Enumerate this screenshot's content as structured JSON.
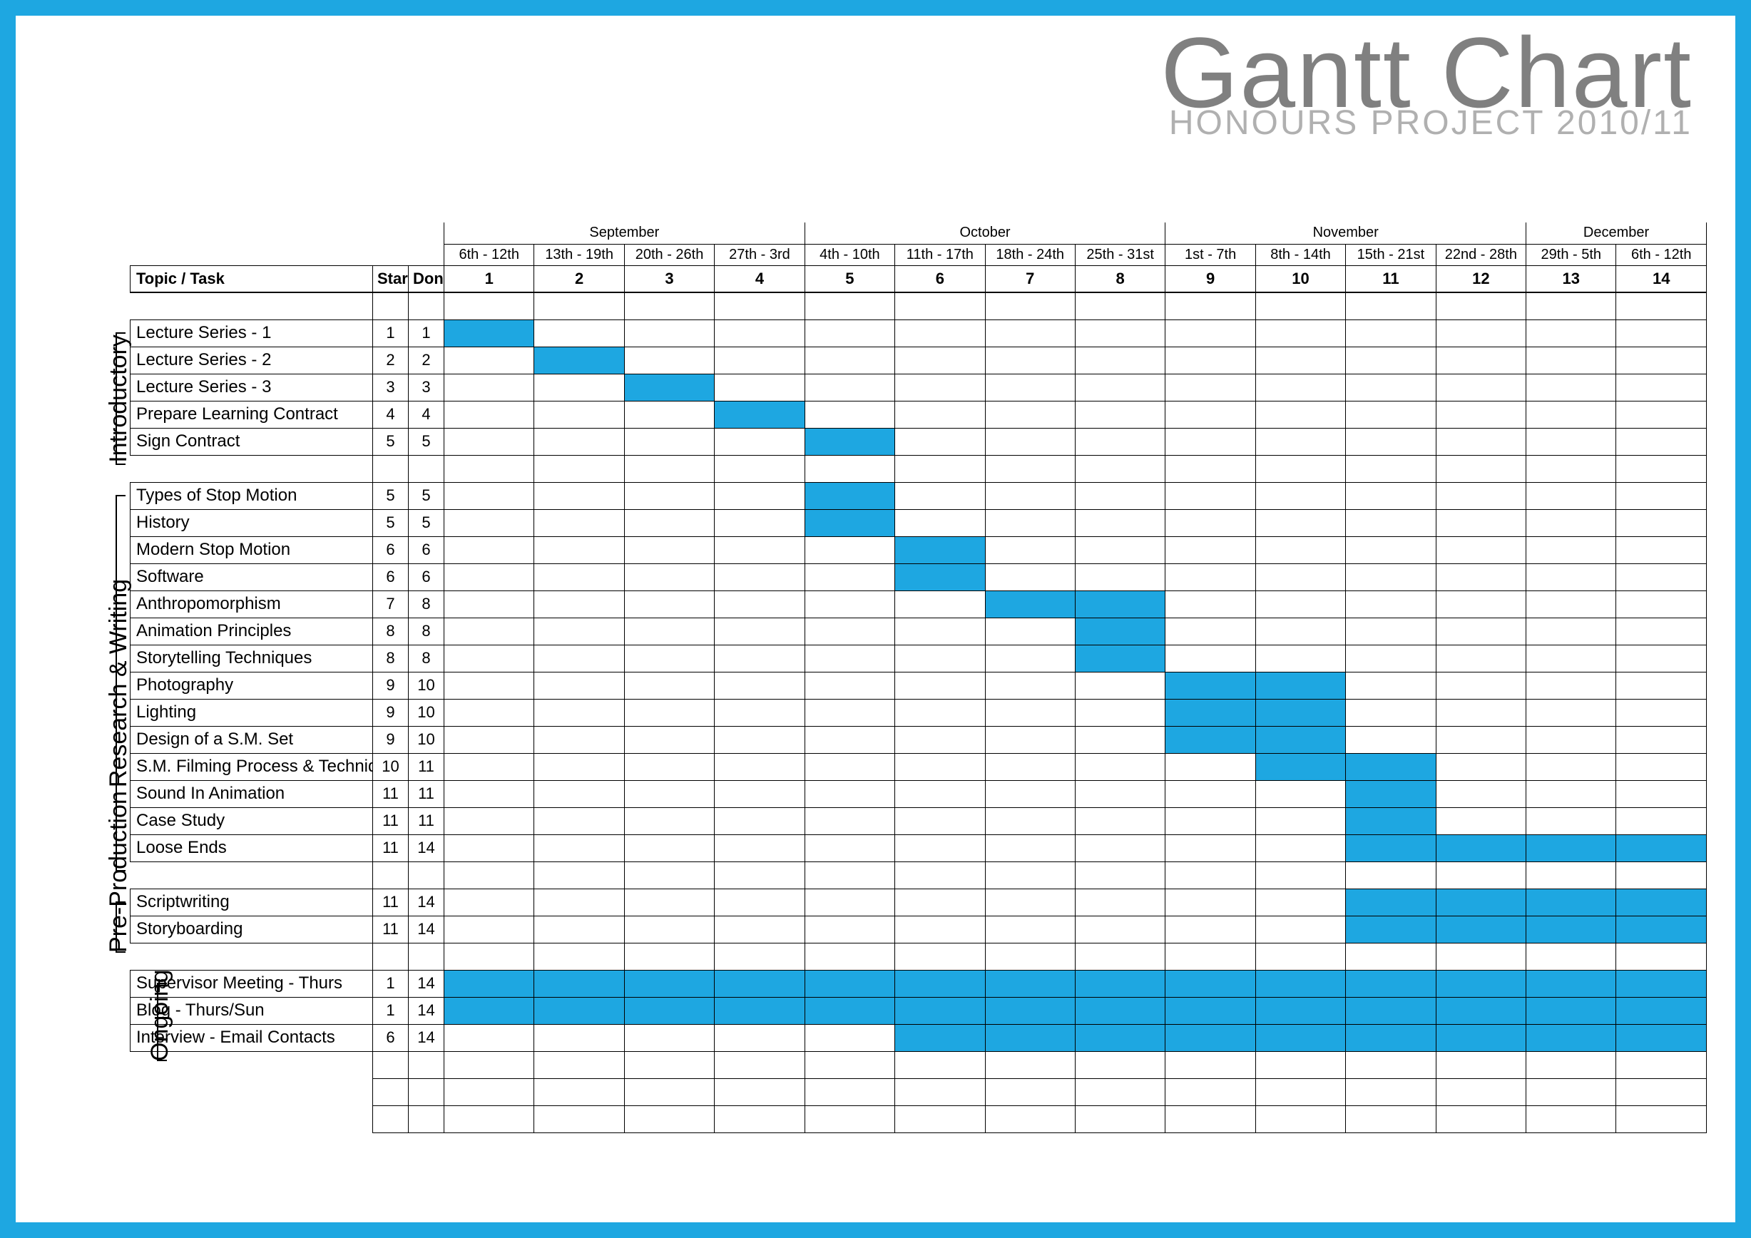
{
  "title": "Gantt Chart",
  "subtitle": "HONOURS PROJECT 2010/11",
  "header": {
    "task": "Topic / Task",
    "start": "Start",
    "done": "Done"
  },
  "months": [
    {
      "name": "September",
      "span": 4
    },
    {
      "name": "October",
      "span": 4
    },
    {
      "name": "November",
      "span": 4
    },
    {
      "name": "December",
      "span": 2
    }
  ],
  "weeks": [
    {
      "n": 1,
      "range": "6th - 12th"
    },
    {
      "n": 2,
      "range": "13th - 19th"
    },
    {
      "n": 3,
      "range": "20th - 26th"
    },
    {
      "n": 4,
      "range": "27th - 3rd"
    },
    {
      "n": 5,
      "range": "4th - 10th"
    },
    {
      "n": 6,
      "range": "11th - 17th"
    },
    {
      "n": 7,
      "range": "18th - 24th"
    },
    {
      "n": 8,
      "range": "25th - 31st"
    },
    {
      "n": 9,
      "range": "1st - 7th"
    },
    {
      "n": 10,
      "range": "8th - 14th"
    },
    {
      "n": 11,
      "range": "15th - 21st"
    },
    {
      "n": 12,
      "range": "22nd - 28th"
    },
    {
      "n": 13,
      "range": "29th - 5th"
    },
    {
      "n": 14,
      "range": "6th - 12th"
    }
  ],
  "groups": [
    {
      "name": "Introductory",
      "tasks": [
        {
          "name": "Lecture Series - 1",
          "start": 1,
          "done": 1
        },
        {
          "name": "Lecture Series - 2",
          "start": 2,
          "done": 2
        },
        {
          "name": "Lecture Series - 3",
          "start": 3,
          "done": 3
        },
        {
          "name": "Prepare Learning Contract",
          "start": 4,
          "done": 4
        },
        {
          "name": "Sign Contract",
          "start": 5,
          "done": 5
        }
      ]
    },
    {
      "name": "Research & Writing",
      "tasks": [
        {
          "name": "Types of Stop Motion",
          "start": 5,
          "done": 5
        },
        {
          "name": "History",
          "start": 5,
          "done": 5
        },
        {
          "name": "Modern Stop Motion",
          "start": 6,
          "done": 6
        },
        {
          "name": "Software",
          "start": 6,
          "done": 6
        },
        {
          "name": "Anthropomorphism",
          "start": 7,
          "done": 8
        },
        {
          "name": "Animation Principles",
          "start": 8,
          "done": 8
        },
        {
          "name": "Storytelling Techniques",
          "start": 8,
          "done": 8
        },
        {
          "name": "Photography",
          "start": 9,
          "done": 10
        },
        {
          "name": "Lighting",
          "start": 9,
          "done": 10
        },
        {
          "name": "Design of a S.M. Set",
          "start": 9,
          "done": 10
        },
        {
          "name": "S.M. Filming Process & Techniques",
          "start": 10,
          "done": 11
        },
        {
          "name": "Sound In Animation",
          "start": 11,
          "done": 11
        },
        {
          "name": "Case Study",
          "start": 11,
          "done": 11
        },
        {
          "name": "Loose Ends",
          "start": 11,
          "done": 14
        }
      ]
    },
    {
      "name": "Pre-Production",
      "tasks": [
        {
          "name": "Scriptwriting",
          "start": 11,
          "done": 14
        },
        {
          "name": "Storyboarding",
          "start": 11,
          "done": 14
        }
      ]
    },
    {
      "name": "Ongoing",
      "tasks": [
        {
          "name": "Supervisor Meeting - Thurs",
          "start": 1,
          "done": 14
        },
        {
          "name": "Blog - Thurs/Sun",
          "start": 1,
          "done": 14
        },
        {
          "name": "Interview - Email Contacts",
          "start": 6,
          "done": 14
        }
      ]
    }
  ],
  "chart_data": {
    "type": "gantt",
    "title": "Gantt Chart — Honours Project 2010/11",
    "x_unit": "week",
    "x_range": [
      1,
      14
    ],
    "columns": [
      "6th - 12th",
      "13th - 19th",
      "20th - 26th",
      "27th - 3rd",
      "4th - 10th",
      "11th - 17th",
      "18th - 24th",
      "25th - 31st",
      "1st - 7th",
      "8th - 14th",
      "15th - 21st",
      "22nd - 28th",
      "29th - 5th",
      "6th - 12th"
    ],
    "month_groups": [
      {
        "label": "September",
        "weeks": [
          1,
          2,
          3,
          4
        ]
      },
      {
        "label": "October",
        "weeks": [
          5,
          6,
          7,
          8
        ]
      },
      {
        "label": "November",
        "weeks": [
          9,
          10,
          11,
          12
        ]
      },
      {
        "label": "December",
        "weeks": [
          13,
          14
        ]
      }
    ],
    "series": [
      {
        "group": "Introductory",
        "task": "Lecture Series - 1",
        "start": 1,
        "end": 1
      },
      {
        "group": "Introductory",
        "task": "Lecture Series - 2",
        "start": 2,
        "end": 2
      },
      {
        "group": "Introductory",
        "task": "Lecture Series - 3",
        "start": 3,
        "end": 3
      },
      {
        "group": "Introductory",
        "task": "Prepare Learning Contract",
        "start": 4,
        "end": 4
      },
      {
        "group": "Introductory",
        "task": "Sign Contract",
        "start": 5,
        "end": 5
      },
      {
        "group": "Research & Writing",
        "task": "Types of Stop Motion",
        "start": 5,
        "end": 5
      },
      {
        "group": "Research & Writing",
        "task": "History",
        "start": 5,
        "end": 5
      },
      {
        "group": "Research & Writing",
        "task": "Modern Stop Motion",
        "start": 6,
        "end": 6
      },
      {
        "group": "Research & Writing",
        "task": "Software",
        "start": 6,
        "end": 6
      },
      {
        "group": "Research & Writing",
        "task": "Anthropomorphism",
        "start": 7,
        "end": 8
      },
      {
        "group": "Research & Writing",
        "task": "Animation Principles",
        "start": 8,
        "end": 8
      },
      {
        "group": "Research & Writing",
        "task": "Storytelling Techniques",
        "start": 8,
        "end": 8
      },
      {
        "group": "Research & Writing",
        "task": "Photography",
        "start": 9,
        "end": 10
      },
      {
        "group": "Research & Writing",
        "task": "Lighting",
        "start": 9,
        "end": 10
      },
      {
        "group": "Research & Writing",
        "task": "Design of a S.M. Set",
        "start": 9,
        "end": 10
      },
      {
        "group": "Research & Writing",
        "task": "S.M. Filming Process & Techniques",
        "start": 10,
        "end": 11
      },
      {
        "group": "Research & Writing",
        "task": "Sound In Animation",
        "start": 11,
        "end": 11
      },
      {
        "group": "Research & Writing",
        "task": "Case Study",
        "start": 11,
        "end": 11
      },
      {
        "group": "Research & Writing",
        "task": "Loose Ends",
        "start": 11,
        "end": 14
      },
      {
        "group": "Pre-Production",
        "task": "Scriptwriting",
        "start": 11,
        "end": 14
      },
      {
        "group": "Pre-Production",
        "task": "Storyboarding",
        "start": 11,
        "end": 14
      },
      {
        "group": "Ongoing",
        "task": "Supervisor Meeting - Thurs",
        "start": 1,
        "end": 14
      },
      {
        "group": "Ongoing",
        "task": "Blog - Thurs/Sun",
        "start": 1,
        "end": 14
      },
      {
        "group": "Ongoing",
        "task": "Interview - Email Contacts",
        "start": 6,
        "end": 14
      }
    ]
  }
}
